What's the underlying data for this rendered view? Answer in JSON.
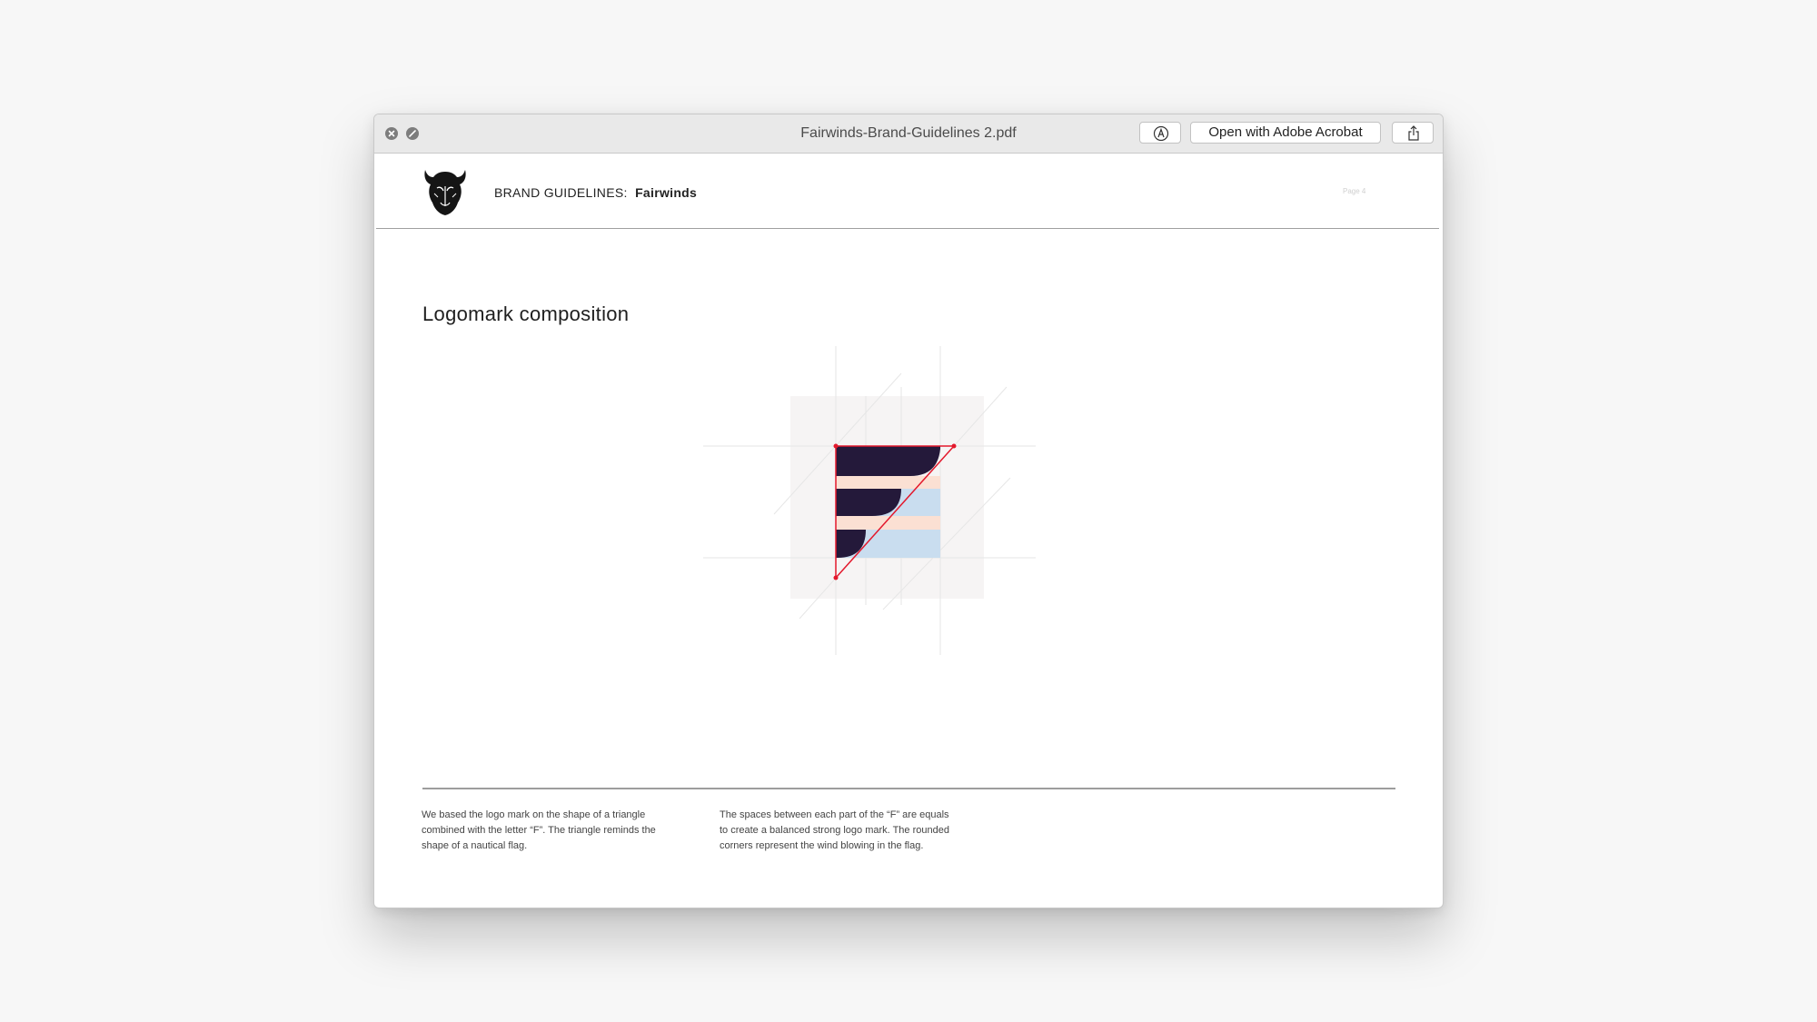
{
  "window": {
    "document_title": "Fairwinds-Brand-Guidelines 2.pdf",
    "open_with_label": "Open with Adobe Acrobat",
    "controls": {
      "close_icon": "close-icon",
      "minimize_icon": "minimize-icon",
      "markup_icon": "markup-icon",
      "share_icon": "share-icon"
    }
  },
  "page": {
    "header": {
      "brand_prefix": "BRAND GUIDELINES:",
      "brand_name": "Fairwinds",
      "page_label": "Page 4",
      "logo_icon": "bison-head-logo-icon"
    },
    "section_title": "Logomark composition",
    "descriptions": [
      {
        "lines": [
          "We based the logo mark on the shape of a triangle",
          "combined with the letter “F”. The triangle reminds the",
          "shape of a nautical flag."
        ]
      },
      {
        "lines": [
          "The spaces between each part of the “F” are equals",
          "to create a balanced strong logo mark. The rounded",
          "corners represent the wind blowing in the flag."
        ]
      }
    ]
  },
  "colors": {
    "navy": "#24193a",
    "peach": "#fbe0d3",
    "light_blue": "#c9ddef",
    "construction_red": "#e3182c",
    "figure_background": "#f6f4f4"
  }
}
